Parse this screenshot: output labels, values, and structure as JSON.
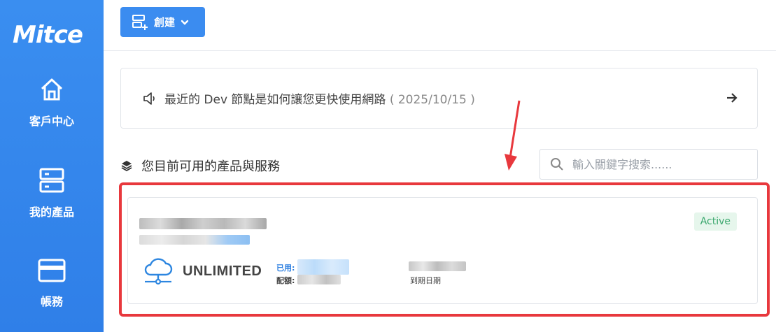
{
  "sidebar": {
    "logo": "Mitce",
    "items": [
      {
        "label": "客戶中心",
        "icon": "home-icon"
      },
      {
        "label": "我的產品",
        "icon": "server-icon"
      },
      {
        "label": "帳務",
        "icon": "credit-card-icon"
      }
    ]
  },
  "topbar": {
    "create_label": "創建",
    "create_icon": "add-list-icon"
  },
  "notice": {
    "icon": "speaker-icon",
    "text": "最近的 Dev 節點是如何讓您更快使用網路",
    "date": "( 2025/10/15 )",
    "arrow_icon": "arrow-right-icon"
  },
  "products": {
    "title": "您目前可用的產品與服務",
    "title_icon": "layers-icon",
    "search_placeholder": "輸入關鍵字搜索......"
  },
  "card": {
    "status": "Active",
    "plan": "UNLIMITED",
    "plan_icon": "cloud-network-icon",
    "used_label": "已用:",
    "quota_label": "配額:",
    "expiry_label": "到期日期"
  },
  "colors": {
    "sidebar": "#3a8ef0",
    "accent": "#3b8cf0",
    "active_bg": "#e6f6ec",
    "active_text": "#3aa76d",
    "highlight": "#e8383d"
  }
}
